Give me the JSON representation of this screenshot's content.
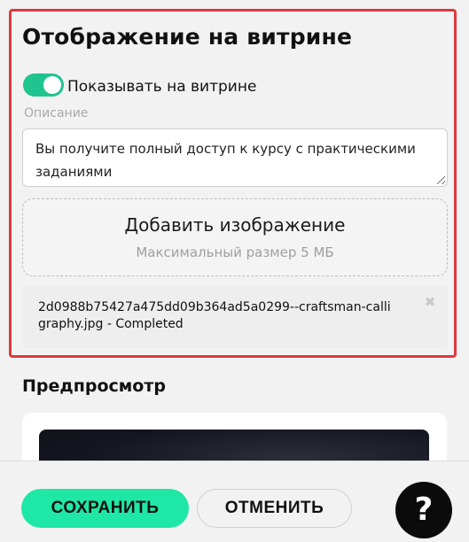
{
  "showcase": {
    "title": "Отображение на витрине",
    "toggle_label": "Показывать на витрине",
    "toggle_on": true,
    "description_label": "Описание",
    "description_value": "Вы получите полный доступ к курсу с практическими заданиями",
    "upload_title": "Добавить изображение",
    "upload_hint": "Максимальный размер 5 МБ",
    "file_name": "2d0988b75427a475dd09b364ad5a0299--craftsman-calligraphy.jpg - Completed",
    "remove_glyph": "✖"
  },
  "preview": {
    "heading": "Предпросмотр"
  },
  "footer": {
    "save_label": "СОХРАНИТЬ",
    "cancel_label": "ОТМЕНИТЬ",
    "help_label": "?"
  },
  "colors": {
    "accent": "#1fe8a6",
    "toggle": "#1fc48f",
    "highlight_border": "#e0393e"
  }
}
